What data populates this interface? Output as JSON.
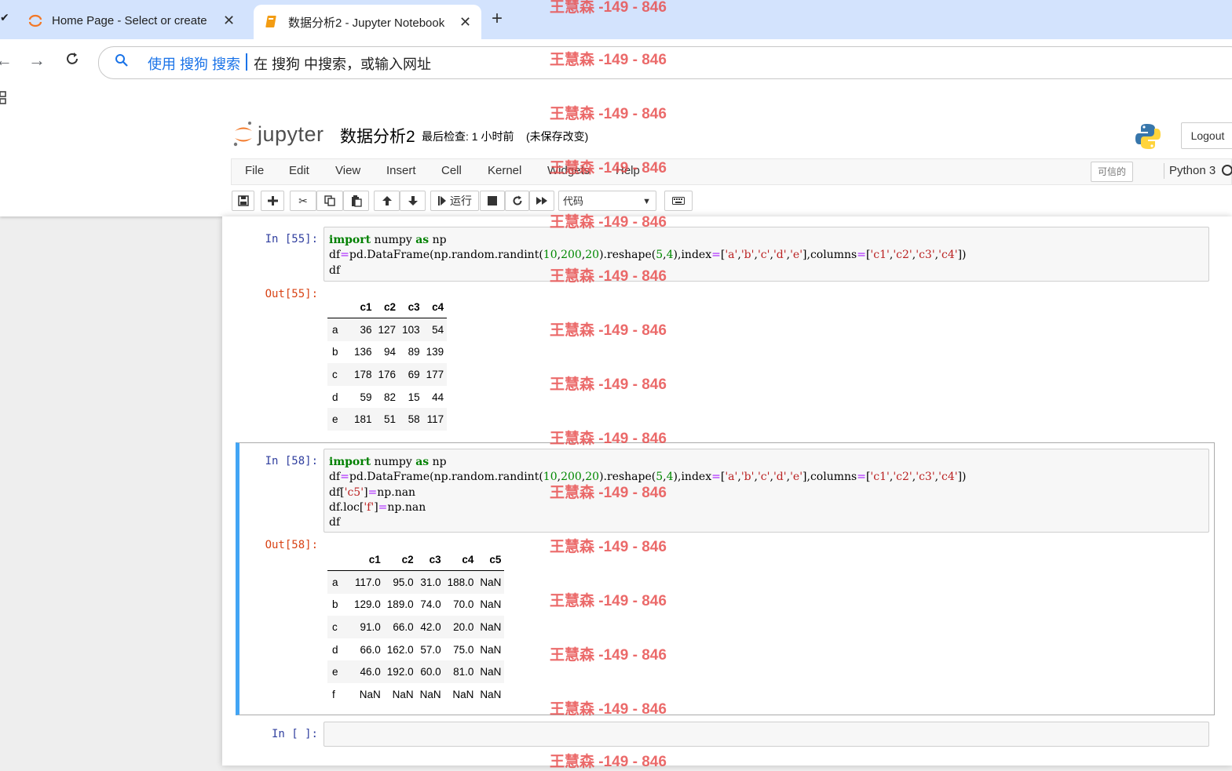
{
  "browser": {
    "tabs": [
      {
        "title": "Home Page - Select or create",
        "active": false
      },
      {
        "title": "数据分析2 - Jupyter Notebook",
        "active": true
      }
    ],
    "new_tab_label": "+",
    "close_label": "✕",
    "address": {
      "search_hint": "使用 搜狗 搜索",
      "placeholder": "在 搜狗 中搜索，或输入网址"
    }
  },
  "jupyter": {
    "logo_text": "jupyter",
    "notebook_name": "数据分析2",
    "checkpoint": "最后检查: 1 小时前",
    "unsaved": "(未保存改变)",
    "logout_label": "Logout",
    "menu": [
      "File",
      "Edit",
      "View",
      "Insert",
      "Cell",
      "Kernel",
      "Widgets",
      "Help"
    ],
    "trusted_label": "可信的",
    "kernel_name": "Python 3",
    "toolbar": {
      "run_label": "运行",
      "cell_type": "代码"
    }
  },
  "cells": [
    {
      "in_prompt": "In  [55]:",
      "out_prompt": "Out[55]:",
      "code_lines": [
        "import numpy as np",
        "df=pd.DataFrame(np.random.randint(10,200,20).reshape(5,4),index=['a','b','c','d','e'],columns=['c1','c2','c3','c4'])",
        "df"
      ],
      "table": {
        "columns": [
          "c1",
          "c2",
          "c3",
          "c4"
        ],
        "rows": [
          {
            "index": "a",
            "values": [
              "36",
              "127",
              "103",
              "54"
            ]
          },
          {
            "index": "b",
            "values": [
              "136",
              "94",
              "89",
              "139"
            ]
          },
          {
            "index": "c",
            "values": [
              "178",
              "176",
              "69",
              "177"
            ]
          },
          {
            "index": "d",
            "values": [
              "59",
              "82",
              "15",
              "44"
            ]
          },
          {
            "index": "e",
            "values": [
              "181",
              "51",
              "58",
              "117"
            ]
          }
        ]
      }
    },
    {
      "in_prompt": "In  [58]:",
      "out_prompt": "Out[58]:",
      "code_lines": [
        "import numpy as np",
        "df=pd.DataFrame(np.random.randint(10,200,20).reshape(5,4),index=['a','b','c','d','e'],columns=['c1','c2','c3','c4'])",
        "df['c5']=np.nan",
        "df.loc['f']=np.nan",
        "df"
      ],
      "table": {
        "columns": [
          "c1",
          "c2",
          "c3",
          "c4",
          "c5"
        ],
        "rows": [
          {
            "index": "a",
            "values": [
              "117.0",
              "95.0",
              "31.0",
              "188.0",
              "NaN"
            ]
          },
          {
            "index": "b",
            "values": [
              "129.0",
              "189.0",
              "74.0",
              "70.0",
              "NaN"
            ]
          },
          {
            "index": "c",
            "values": [
              "91.0",
              "66.0",
              "42.0",
              "20.0",
              "NaN"
            ]
          },
          {
            "index": "d",
            "values": [
              "66.0",
              "162.0",
              "57.0",
              "75.0",
              "NaN"
            ]
          },
          {
            "index": "e",
            "values": [
              "46.0",
              "192.0",
              "60.0",
              "81.0",
              "NaN"
            ]
          },
          {
            "index": "f",
            "values": [
              "NaN",
              "NaN",
              "NaN",
              "NaN",
              "NaN"
            ]
          }
        ]
      }
    },
    {
      "in_prompt": "In  [ ]:"
    }
  ],
  "watermark": "王慧森 -149 - 846",
  "colors": {
    "tabbar": "#d3e3fd",
    "selected_cell_border": "#42a5f5",
    "in_prompt": "#303f9f",
    "out_prompt": "#d84315"
  }
}
